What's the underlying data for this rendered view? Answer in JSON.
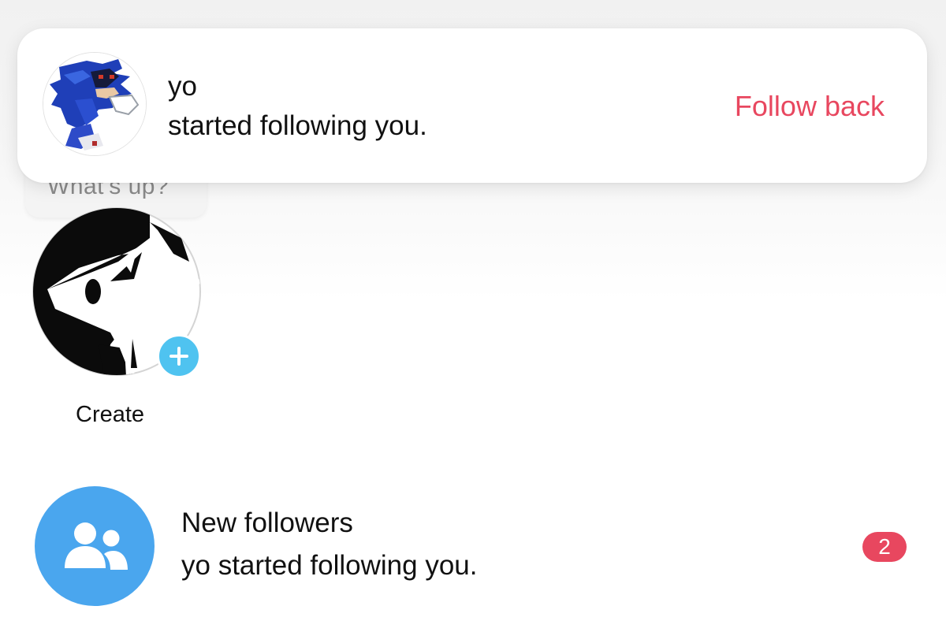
{
  "notification": {
    "username": "yo",
    "message": "started following you.",
    "action_label": "Follow back",
    "action_color": "#e8475f"
  },
  "draft": {
    "text": "What's up?"
  },
  "story": {
    "create_label": "Create",
    "plus_color": "#4fc3f0"
  },
  "new_followers": {
    "title": "New followers",
    "subtitle": "yo started following you.",
    "badge_count": "2",
    "icon": "people-icon",
    "icon_bg": "#4aa6ee",
    "badge_color": "#e8475f"
  }
}
